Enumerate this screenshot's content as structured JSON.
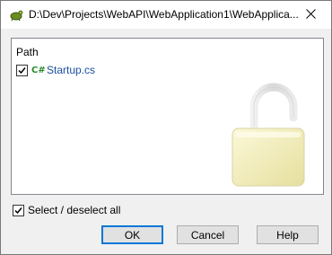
{
  "window": {
    "title": "D:\\Dev\\Projects\\WebAPI\\WebApplication1\\WebApplica...",
    "app_icon": "tortoise-icon",
    "close_icon": "close-icon"
  },
  "list": {
    "column_header": "Path",
    "items": [
      {
        "checked": true,
        "icon": "csharp-file-icon",
        "icon_text": "C#",
        "name": "Startup.cs"
      }
    ],
    "overlay_icon": "unlocked-padlock-icon"
  },
  "select_all": {
    "checked": true,
    "label": "Select / deselect all"
  },
  "buttons": {
    "ok": "OK",
    "cancel": "Cancel",
    "help": "Help"
  },
  "colors": {
    "accent": "#0078d7",
    "file_link": "#1a4fa0",
    "cs_icon": "#2a8a2a"
  }
}
